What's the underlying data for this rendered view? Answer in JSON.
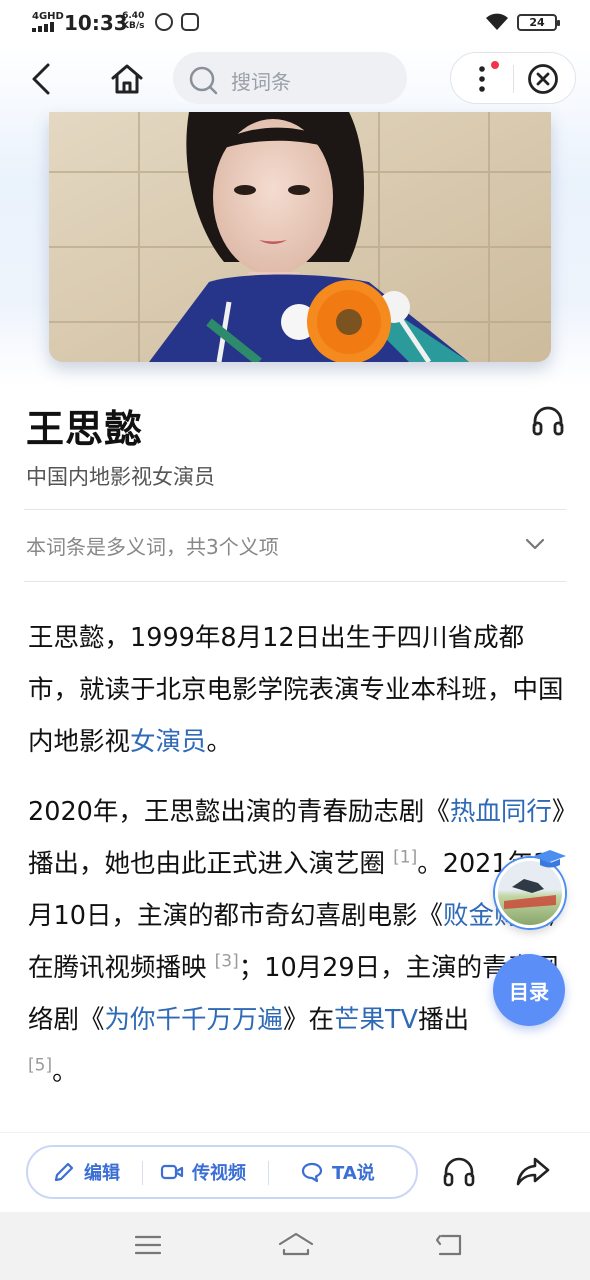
{
  "status_bar": {
    "network": "4GHD",
    "time": "10:33",
    "speed_value": "6.40",
    "speed_unit": "KB/s",
    "battery": "24"
  },
  "nav": {
    "search_placeholder": "搜词条",
    "icons": [
      "back-icon",
      "home-icon",
      "search-icon",
      "more-icon",
      "close-icon"
    ]
  },
  "entry": {
    "title": "王思懿",
    "subtitle": "中国内地影视女演员",
    "polysemy": "本词条是多义词，共3个义项"
  },
  "paragraph1": {
    "text1": "王思懿，1999年8月12日出生于四川省成都市，就读于北京电影学院表演专业本科班，中国内地影视",
    "link1": "女演员",
    "text2": "。"
  },
  "paragraph2": {
    "t1": "2020年，王思懿出演的青春励志剧《",
    "l1": "热血同行",
    "t2": "》播出，她也由此正式进入演艺圈",
    "c1": "[1]",
    "t3": "。2021年3月10日，主演的都市奇幻喜剧电影《",
    "l2": "败金财神",
    "t4": "》在腾讯视频播映",
    "c2": "[3]",
    "t5": "；10月29日，主演的青春网络剧《",
    "l3": "为你千千万万遍",
    "t6": "》在",
    "l4": "芒果TV",
    "t7": "播出",
    "c3": "[5]",
    "t8": "。"
  },
  "floating": {
    "toc_label": "目录"
  },
  "action_bar": {
    "edit_label": "编辑",
    "video_label": "传视频",
    "talk_label": "TA说"
  },
  "colors": {
    "link": "#2f6ab7",
    "accent": "#3b6fd6",
    "toc_button": "#5b8ef7",
    "notification_dot": "#f2344a"
  }
}
